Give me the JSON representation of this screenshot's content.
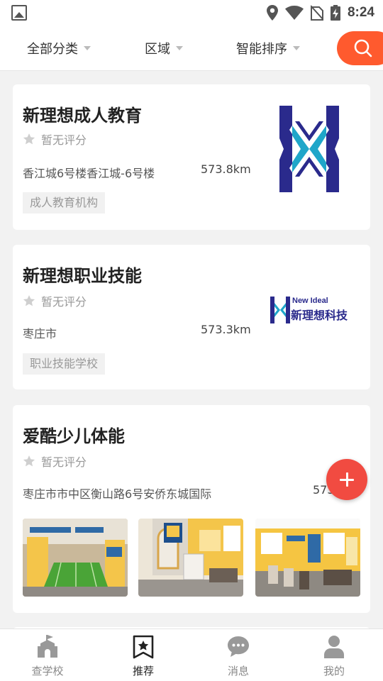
{
  "status_bar": {
    "time": "8:24",
    "icons": [
      "gallery-icon",
      "location-icon",
      "wifi-icon",
      "no-sim-icon",
      "battery-charging-icon"
    ]
  },
  "filters": [
    {
      "label": "全部分类",
      "icon": "caret-down-icon"
    },
    {
      "label": "区域",
      "icon": "caret-down-icon"
    },
    {
      "label": "智能排序",
      "icon": "caret-down-icon"
    }
  ],
  "search": {
    "icon": "search-icon",
    "color": "#ff5a2e"
  },
  "listings": [
    {
      "name": "新理想成人教育",
      "rating": "暂无评分",
      "address": "香江城6号楼香江城-6号楼",
      "distance": "573.8km",
      "tag": "成人教育机构",
      "logo": "x-logo"
    },
    {
      "name": "新理想职业技能",
      "rating": "暂无评分",
      "address": "枣庄市",
      "distance": "573.3km",
      "tag": "职业技能学校",
      "logo_text_en": "New Ideal",
      "logo_text_cn": "新理想科技"
    },
    {
      "name": "爱酷少儿体能",
      "rating": "暂无评分",
      "address": "枣庄市市中区衡山路6号安侨东城国际",
      "distance": "573",
      "photos": [
        "gym-photo-1",
        "gym-photo-2",
        "gym-photo-3"
      ]
    }
  ],
  "fab": {
    "icon": "plus-icon",
    "color": "#f14b41"
  },
  "bottom_nav": [
    {
      "label": "查学校",
      "icon": "school-icon",
      "active": false
    },
    {
      "label": "推荐",
      "icon": "bookmark-star-icon",
      "active": true
    },
    {
      "label": "消息",
      "icon": "chat-bubble-icon",
      "active": false
    },
    {
      "label": "我的",
      "icon": "person-icon",
      "active": false
    }
  ],
  "colors": {
    "accent": "#ff5a2e",
    "fab": "#f14b41",
    "logo_blue": "#2a2a8c",
    "logo_teal": "#1fa6c9"
  }
}
